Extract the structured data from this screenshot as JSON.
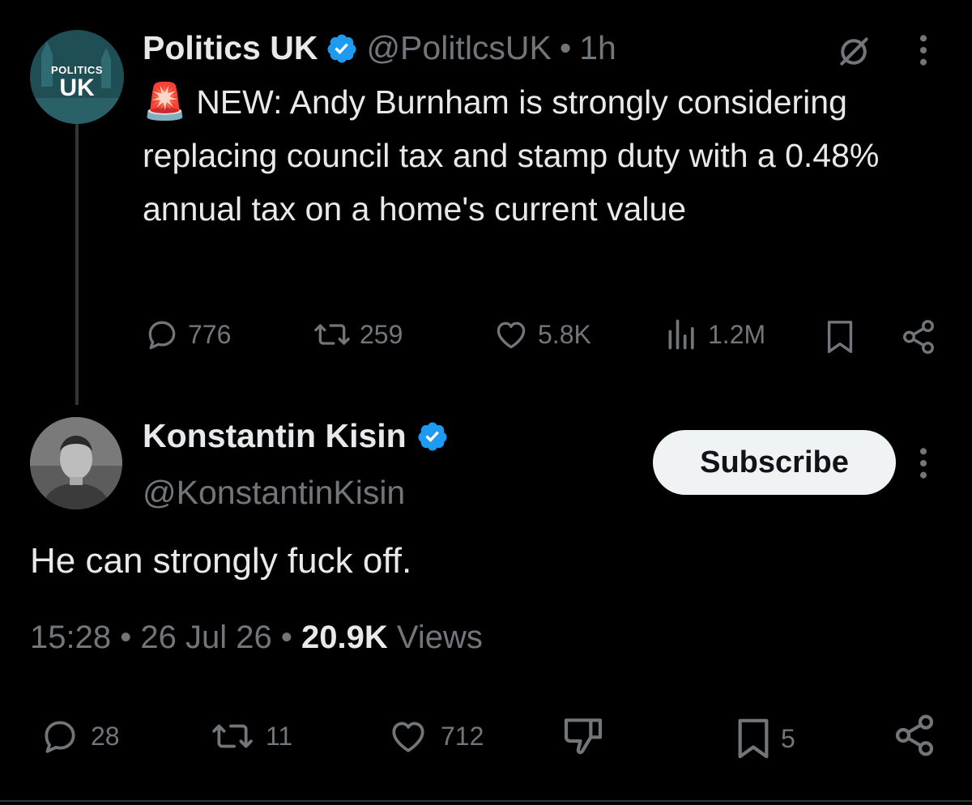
{
  "original_tweet": {
    "avatar_text_small": "POLITICS",
    "avatar_text_big": "UK",
    "display_name": "Politics UK",
    "handle": "@PolitlcsUK",
    "separator": "•",
    "time_ago": "1h",
    "emoji": "🚨",
    "text": "NEW: Andy Burnham is strongly considering replacing council tax and stamp duty with a 0.48% annual tax on a home's current value",
    "replies": "776",
    "reposts": "259",
    "likes": "5.8K",
    "views": "1.2M"
  },
  "reply_tweet": {
    "display_name": "Konstantin Kisin",
    "handle": "@KonstantinKisin",
    "subscribe_label": "Subscribe",
    "text": "He can strongly fuck off.",
    "time": "15:28",
    "separator": "•",
    "date": "26 Jul 26",
    "views_count": "20.9K",
    "views_label": "Views",
    "replies": "28",
    "reposts": "11",
    "likes": "712",
    "bookmarks": "5"
  },
  "colors": {
    "background": "#000000",
    "text": "#e7e9ea",
    "muted": "#71767b",
    "verified": "#1d9bf0",
    "subscribe_bg": "#eff3f4",
    "politics_uk_avatar": "#1f4e55"
  },
  "icons": [
    "grok-icon",
    "more-icon",
    "verified-badge-icon",
    "reply-icon",
    "repost-icon",
    "like-icon",
    "views-icon",
    "bookmark-icon",
    "share-icon",
    "dislike-icon"
  ]
}
